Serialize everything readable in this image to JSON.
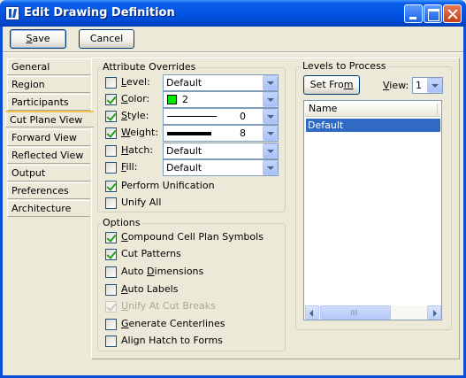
{
  "window": {
    "title": "Edit Drawing Definition"
  },
  "toolbar": {
    "save_mnemonic": "S",
    "save_rest": "ave",
    "cancel_label": "Cancel"
  },
  "tabs": [
    {
      "label": "General"
    },
    {
      "label": "Region"
    },
    {
      "label": "Participants"
    },
    {
      "label": "Cut Plane View"
    },
    {
      "label": "Forward View"
    },
    {
      "label": "Reflected View"
    },
    {
      "label": "Output"
    },
    {
      "label": "Preferences"
    },
    {
      "label": "Architecture"
    }
  ],
  "active_tab": "Cut Plane View",
  "attribute_overrides": {
    "title": "Attribute Overrides",
    "level": {
      "pre": "",
      "mn": "L",
      "post": "evel:",
      "checked": false,
      "value": "Default"
    },
    "color": {
      "pre": "",
      "mn": "C",
      "post": "olor:",
      "checked": true,
      "value": "2",
      "swatch": "#00e600"
    },
    "style": {
      "pre": "",
      "mn": "S",
      "post": "tyle:",
      "checked": true,
      "value": "0"
    },
    "weight": {
      "pre": "",
      "mn": "W",
      "post": "eight:",
      "checked": true,
      "value": "8"
    },
    "hatch": {
      "pre": "",
      "mn": "H",
      "post": "atch:",
      "checked": false,
      "value": "Default"
    },
    "fill": {
      "pre": "",
      "mn": "F",
      "post": "ill:",
      "checked": false,
      "value": "Default"
    },
    "perform_unification": {
      "label": "Perform Unification",
      "checked": true
    },
    "unify_all": {
      "label": "Unify All",
      "checked": false
    }
  },
  "options": {
    "title": "Options",
    "items": [
      {
        "pre": "",
        "mn": "C",
        "post": "ompound Cell Plan Symbols",
        "checked": true,
        "disabled": false
      },
      {
        "pre": "",
        "mn": "",
        "post": "Cut Patterns",
        "checked": true,
        "disabled": false
      },
      {
        "pre": "Auto ",
        "mn": "D",
        "post": "imensions",
        "checked": false,
        "disabled": false
      },
      {
        "pre": "",
        "mn": "A",
        "post": "uto Labels",
        "checked": false,
        "disabled": false
      },
      {
        "pre": "",
        "mn": "U",
        "post": "nify At Cut Breaks",
        "checked": true,
        "disabled": true
      },
      {
        "pre": "",
        "mn": "G",
        "post": "enerate Centerlines",
        "checked": false,
        "disabled": false
      },
      {
        "pre": "Align Hatch to Forms",
        "mn": "",
        "post": "",
        "checked": false,
        "disabled": false
      }
    ]
  },
  "levels": {
    "title": "Levels to Process",
    "set_from_pre": "Set Fro",
    "set_from_mn": "m",
    "view_label_pre": "",
    "view_label_mn": "V",
    "view_label_post": "iew:",
    "view_value": "1",
    "column_header": "Name",
    "rows": [
      "Default"
    ]
  },
  "colors": {
    "titlebar": "#0054e3",
    "selection": "#316ac5",
    "face": "#ece9d8"
  }
}
